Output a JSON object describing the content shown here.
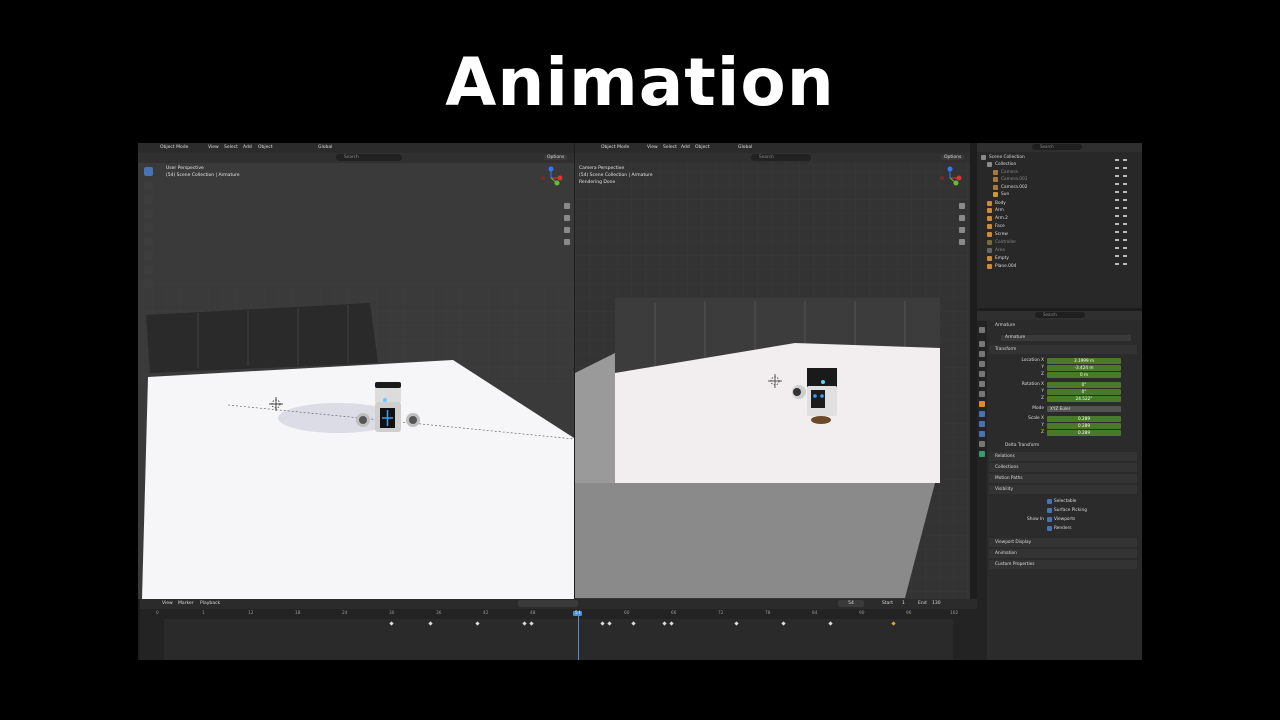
{
  "slide_title": "Animation",
  "viewport_left": {
    "menu": [
      "Object Mode",
      "View",
      "Select",
      "Add",
      "Object"
    ],
    "transform_orientation": "Global",
    "search_placeholder": "Search",
    "options_label": "Options",
    "overlay_line1": "User Perspective",
    "overlay_line2": "(54) Scene Collection | Armature"
  },
  "viewport_right": {
    "menu": [
      "Object Mode",
      "View",
      "Select",
      "Add",
      "Object"
    ],
    "transform_orientation": "Global",
    "search_placeholder": "Search",
    "options_label": "Options",
    "overlay_line1": "Camera Perspective",
    "overlay_line2": "(54) Scene Collection | Armature",
    "overlay_line3": "Rendering Done"
  },
  "outliner": {
    "search_placeholder": "Search",
    "rows": [
      "Scene Collection",
      "Collection",
      "Camera",
      "Camera.001",
      "Camera.002",
      "Sun",
      "Body",
      "Arm",
      "Arm.2",
      "Face",
      "Screw",
      "Controller",
      "Area",
      "Empty",
      "Plane.004"
    ]
  },
  "properties": {
    "search_placeholder": "Search",
    "object_name": "Armature",
    "object_data_name": "Armature",
    "transform_header": "Transform",
    "location_label": "Location X",
    "location": [
      "3.1999 m",
      "-3.424 m",
      "0 m"
    ],
    "rotation_label": "Rotation X",
    "rotation": [
      "0°",
      "0°",
      "24.522°"
    ],
    "axis_y": "Y",
    "axis_z": "Z",
    "mode_label": "Mode",
    "mode_value": "XYZ Euler",
    "scale_label": "Scale X",
    "scale": [
      "0.289",
      "0.289",
      "0.289"
    ],
    "delta_transform": "Delta Transform",
    "panels_collapsed": [
      "Relations",
      "Collections",
      "Motion Paths"
    ],
    "visibility_header": "Visibility",
    "selectable": "Selectable",
    "surface_picking": "Surface Picking",
    "show_in_label": "Show In",
    "viewports": "Viewports",
    "renders": "Renders",
    "panels_bottom": [
      "Viewport Display",
      "Animation",
      "Custom Properties"
    ]
  },
  "timeline": {
    "menu": [
      "View",
      "Marker",
      "Playback"
    ],
    "current_frame": "54",
    "start_label": "Start",
    "start_value": "1",
    "end_label": "End",
    "end_value": "130",
    "ruler": [
      "0",
      "1",
      "12",
      "18",
      "24",
      "30",
      "36",
      "42",
      "48",
      "54",
      "60",
      "66",
      "72",
      "78",
      "84",
      "90",
      "96",
      "102"
    ]
  },
  "colors": {
    "selection_blue": "#4772b3",
    "field_green": "#4a7a29",
    "playhead": "#4a8ee0"
  }
}
